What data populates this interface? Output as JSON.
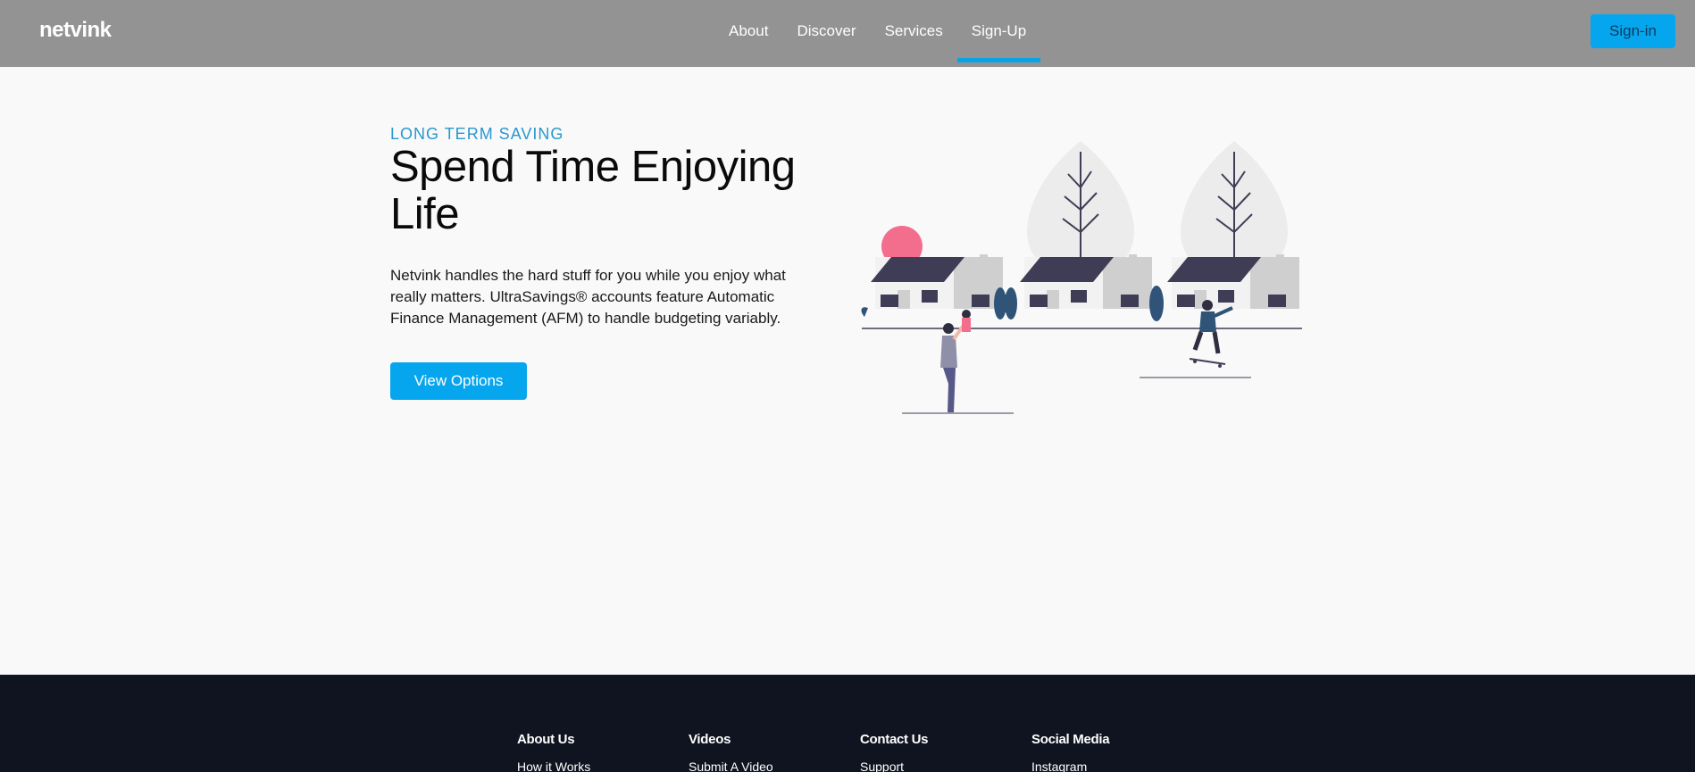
{
  "nav": {
    "brand": "netvink",
    "links": [
      {
        "label": "About"
      },
      {
        "label": "Discover"
      },
      {
        "label": "Services"
      },
      {
        "label": "Sign-Up",
        "active": true
      }
    ],
    "signin_label": "Sign-in"
  },
  "hero": {
    "eyebrow": "LONG TERM SAVING",
    "headline": "Spend Time Enjoying Life",
    "description": "Netvink handles the hard stuff for you while you enjoy what really matters. UltraSavings® accounts feature Automatic Finance Management (AFM) to handle budgeting variably.",
    "cta_label": "View Options"
  },
  "footer": {
    "columns": [
      {
        "heading": "About Us",
        "links": [
          "How it Works"
        ]
      },
      {
        "heading": "Videos",
        "links": [
          "Submit A Video"
        ]
      },
      {
        "heading": "Contact Us",
        "links": [
          "Support"
        ]
      },
      {
        "heading": "Social Media",
        "links": [
          "Instagram"
        ]
      }
    ]
  },
  "colors": {
    "navbar": "#939393",
    "accent": "#06a6ee",
    "eyebrow": "#2a97cf",
    "footer": "#0f1420",
    "sun": "#f36e8c",
    "roof": "#3f3d56",
    "tree": "#2f5478"
  }
}
